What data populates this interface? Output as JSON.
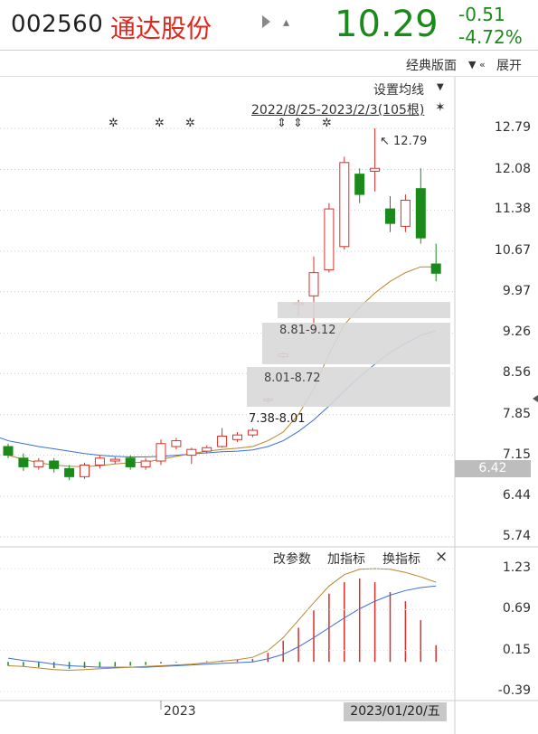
{
  "header": {
    "code": "002560",
    "name": "通达股份",
    "price": "10.29",
    "change": "-0.51",
    "change_pct": "-4.72%",
    "price_color": "#1a8a1a",
    "name_color": "#e1261c",
    "play_icon": "play-icon",
    "bell_icon": "bell-icon"
  },
  "subbar": {
    "classic_label": "经典版面",
    "expand_label": "展开"
  },
  "chart_toolbar": {
    "ma_settings": "设置均线",
    "range": "2022/8/25-2023/2/3(105根)"
  },
  "price_axis": [
    "12.79",
    "12.08",
    "11.38",
    "10.67",
    "9.97",
    "9.26",
    "8.56",
    "7.85",
    "7.15",
    "6.44",
    "5.74"
  ],
  "high_marker": "12.79",
  "zones": [
    {
      "label": "8.81-9.12"
    },
    {
      "label": "8.01-8.72"
    },
    {
      "label": "7.38-8.01"
    }
  ],
  "current_price_box": "6.42",
  "indicator_toolbar": {
    "change_params": "改参数",
    "add_indicator": "加指标",
    "swap_indicator": "换指标",
    "close": "×"
  },
  "indicator_axis": [
    "1.23",
    "0.69",
    "0.15",
    "-0.39"
  ],
  "x_axis": {
    "year_label": "2023",
    "cursor_date": "2023/01/20/五"
  },
  "chart_data": {
    "type": "candlestick",
    "up_color": "#d9302a",
    "down_color": "#1a8a1a",
    "ylim": [
      5.74,
      12.79
    ],
    "candles": [
      {
        "o": 7.3,
        "c": 7.15,
        "h": 7.35,
        "l": 7.1
      },
      {
        "o": 7.1,
        "c": 6.95,
        "h": 7.18,
        "l": 6.88
      },
      {
        "o": 6.95,
        "c": 7.05,
        "h": 7.1,
        "l": 6.9
      },
      {
        "o": 7.05,
        "c": 6.92,
        "h": 7.1,
        "l": 6.85
      },
      {
        "o": 6.92,
        "c": 6.78,
        "h": 6.98,
        "l": 6.72
      },
      {
        "o": 6.78,
        "c": 6.98,
        "h": 7.02,
        "l": 6.74
      },
      {
        "o": 6.98,
        "c": 7.1,
        "h": 7.15,
        "l": 6.92
      },
      {
        "o": 7.05,
        "c": 7.08,
        "h": 7.12,
        "l": 7.0
      },
      {
        "o": 7.1,
        "c": 6.95,
        "h": 7.15,
        "l": 6.9
      },
      {
        "o": 6.95,
        "c": 7.05,
        "h": 7.1,
        "l": 6.9
      },
      {
        "o": 7.05,
        "c": 7.35,
        "h": 7.42,
        "l": 6.98
      },
      {
        "o": 7.3,
        "c": 7.4,
        "h": 7.45,
        "l": 7.25
      },
      {
        "o": 7.15,
        "c": 7.25,
        "h": 7.28,
        "l": 7.0
      },
      {
        "o": 7.22,
        "c": 7.28,
        "h": 7.32,
        "l": 7.18
      },
      {
        "o": 7.3,
        "c": 7.48,
        "h": 7.62,
        "l": 7.28
      },
      {
        "o": 7.42,
        "c": 7.5,
        "h": 7.55,
        "l": 7.38
      },
      {
        "o": 7.5,
        "c": 7.58,
        "h": 7.62,
        "l": 7.46
      },
      {
        "o": 8.09,
        "c": 8.12,
        "h": 8.15,
        "l": 8.05
      },
      {
        "o": 8.85,
        "c": 8.9,
        "h": 8.93,
        "l": 8.81
      },
      {
        "o": 9.75,
        "c": 9.78,
        "h": 9.83,
        "l": 9.55
      },
      {
        "o": 9.9,
        "c": 10.3,
        "h": 10.58,
        "l": 9.28
      },
      {
        "o": 10.35,
        "c": 11.4,
        "h": 11.5,
        "l": 10.3
      },
      {
        "o": 10.75,
        "c": 12.2,
        "h": 12.3,
        "l": 10.7
      },
      {
        "o": 12.0,
        "c": 11.65,
        "h": 12.1,
        "l": 11.5
      },
      {
        "o": 12.05,
        "c": 12.1,
        "h": 12.79,
        "l": 11.7
      },
      {
        "o": 11.4,
        "c": 11.15,
        "h": 11.62,
        "l": 11.0
      },
      {
        "o": 11.1,
        "c": 11.55,
        "h": 11.65,
        "l": 11.0
      },
      {
        "o": 11.75,
        "c": 10.9,
        "h": 12.1,
        "l": 10.8
      },
      {
        "o": 10.45,
        "c": 10.29,
        "h": 10.8,
        "l": 10.15
      }
    ],
    "ma_short": [
      7.15,
      7.08,
      7.02,
      6.98,
      6.96,
      6.95,
      6.97,
      7.0,
      7.02,
      7.03,
      7.08,
      7.13,
      7.18,
      7.22,
      7.25,
      7.27,
      7.3,
      7.4,
      7.55,
      7.85,
      8.3,
      8.9,
      9.4,
      9.7,
      9.95,
      10.15,
      10.3,
      10.4,
      10.4
    ],
    "ma_long": [
      7.4,
      7.35,
      7.3,
      7.26,
      7.22,
      7.18,
      7.15,
      7.13,
      7.12,
      7.12,
      7.13,
      7.15,
      7.17,
      7.19,
      7.21,
      7.22,
      7.24,
      7.3,
      7.4,
      7.56,
      7.76,
      8.0,
      8.26,
      8.5,
      8.72,
      8.92,
      9.08,
      9.22,
      9.3
    ],
    "macd_bars": [
      -0.05,
      -0.06,
      -0.07,
      -0.08,
      -0.09,
      -0.08,
      -0.07,
      -0.06,
      -0.05,
      -0.04,
      -0.02,
      -0.01,
      0.0,
      0.01,
      0.02,
      0.03,
      0.04,
      0.12,
      0.28,
      0.45,
      0.68,
      0.9,
      1.05,
      1.1,
      1.05,
      0.92,
      0.8,
      0.55,
      0.22
    ],
    "macd_dif": [
      -0.05,
      -0.06,
      -0.08,
      -0.1,
      -0.11,
      -0.1,
      -0.09,
      -0.08,
      -0.07,
      -0.06,
      -0.05,
      -0.04,
      -0.03,
      -0.01,
      0.01,
      0.03,
      0.06,
      0.15,
      0.32,
      0.55,
      0.78,
      1.0,
      1.15,
      1.22,
      1.23,
      1.22,
      1.18,
      1.12,
      1.05
    ],
    "macd_dea": [
      0.05,
      0.02,
      0.0,
      -0.03,
      -0.05,
      -0.06,
      -0.07,
      -0.07,
      -0.07,
      -0.07,
      -0.06,
      -0.05,
      -0.04,
      -0.03,
      -0.02,
      -0.01,
      0.0,
      0.04,
      0.1,
      0.2,
      0.32,
      0.45,
      0.58,
      0.7,
      0.8,
      0.88,
      0.94,
      0.98,
      1.0
    ],
    "indicator_ylim": [
      -0.39,
      1.23
    ]
  }
}
